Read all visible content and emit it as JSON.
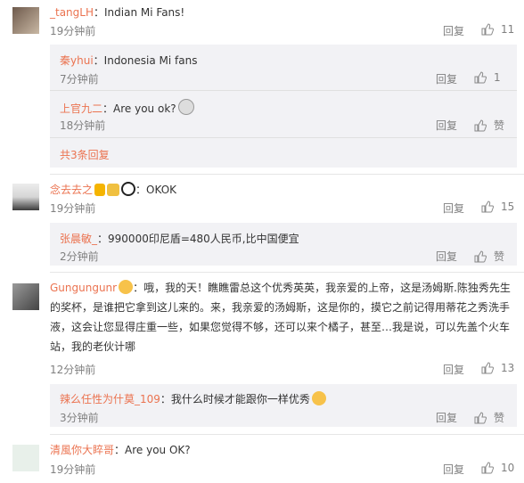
{
  "comments": [
    {
      "user": "_tangLH",
      "text": "Indian Mi Fans!",
      "time": "19分钟前",
      "reply": "回复",
      "likes": "11",
      "replies": [
        {
          "user": "秦yhui",
          "text": "Indonesia Mi fans",
          "time": "7分钟前",
          "reply": "回复",
          "likes": "1"
        },
        {
          "user": "上官九二",
          "text": "Are you ok?",
          "time": "18分钟前",
          "reply": "回复",
          "likes": "赞"
        }
      ],
      "more": "共3条回复"
    },
    {
      "user": "念去去之",
      "text": "OKOK",
      "time": "19分钟前",
      "reply": "回复",
      "likes": "15",
      "replies": [
        {
          "user": "张晨敏_",
          "text": "990000印尼盾=480人民币,比中国便宜",
          "time": "2分钟前",
          "reply": "回复",
          "likes": "赞"
        }
      ]
    },
    {
      "user": "Gungungunr",
      "text_lines": [
        "：哦，我的天！瞧瞧雷总这个优秀英英，我亲爱的上帝，这是汤姆斯.陈独秀先生",
        "的奖杯，是谁把它拿到这儿来的。来，我亲爱的汤姆斯，这是你的，摸它之前记得用蒂花之秀洗手",
        "液，这会让您显得庄重一些，如果您觉得不够，还可以来个橘子，甚至…我是说，可以先盖个火车",
        "站，我的老伙计哪"
      ],
      "time": "12分钟前",
      "reply": "回复",
      "likes": "13",
      "replies": [
        {
          "user": "辣么任性为什莫_109",
          "text": "我什么时候才能跟你一样优秀",
          "time": "3分钟前",
          "reply": "回复",
          "likes": "赞"
        }
      ]
    },
    {
      "user": "清風你大睟哥",
      "text": "Are you OK?",
      "time": "19分钟前",
      "reply": "回复",
      "likes": "10"
    }
  ],
  "colors": {
    "username": "#eb7350",
    "meta": "#808080",
    "subbox": "#f2f2f5"
  }
}
